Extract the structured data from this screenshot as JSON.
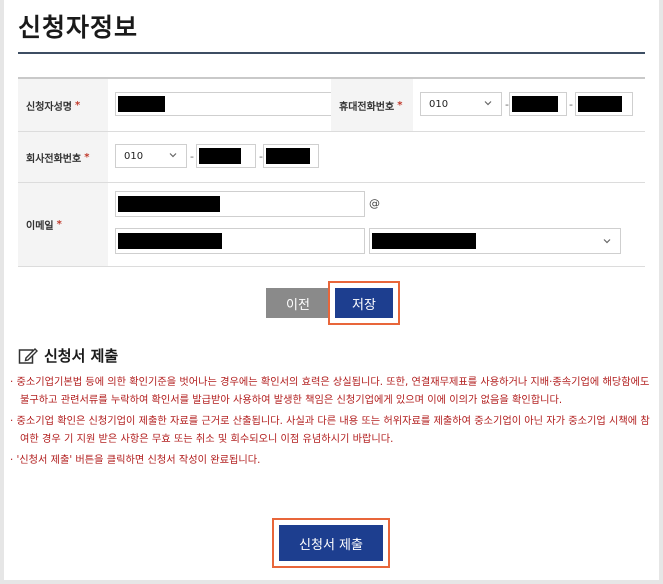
{
  "page_title": "신청자정보",
  "form": {
    "applicant_name_label": "신청자성명",
    "mobile_label": "휴대전화번호",
    "mobile_prefix": "010",
    "company_phone_label": "회사전화번호",
    "company_phone_prefix": "010",
    "email_label": "이메일",
    "required_mark": "*",
    "at_sign": "@",
    "dash": "-"
  },
  "buttons": {
    "prev_label": "이전",
    "save_label": "저장",
    "submit_label": "신청서 제출"
  },
  "section": {
    "title": "신청서 제출",
    "notes": [
      "· 중소기업기본법 등에 의한 확인기준을 벗어나는 경우에는 확인서의 효력은 상실됩니다. 또한, 연결재무제표를 사용하거나 지배·종속기업에 해당함에도 불구하고 관련서류를 누락하여 확인서를 발급받아 사용하여 발생한 책임은 신청기업에게 있으며 이에 이의가 없음을 확인합니다.",
      "· 중소기업 확인은 신청기업이 제출한 자료를 근거로 산출됩니다. 사실과 다른 내용 또는 허위자료를 제출하여 중소기업이 아닌 자가 중소기업 시책에 참여한 경우 기 지원 받은 사항은 무효 또는 취소 및 회수되오니 이점 유념하시기 바랍니다.",
      "· '신청서 제출' 버튼을 클릭하면 신청서 작성이 완료됩니다."
    ]
  },
  "colors": {
    "primary": "#1d3e8f",
    "highlight": "#e8663a",
    "notice": "#b21e1e"
  }
}
